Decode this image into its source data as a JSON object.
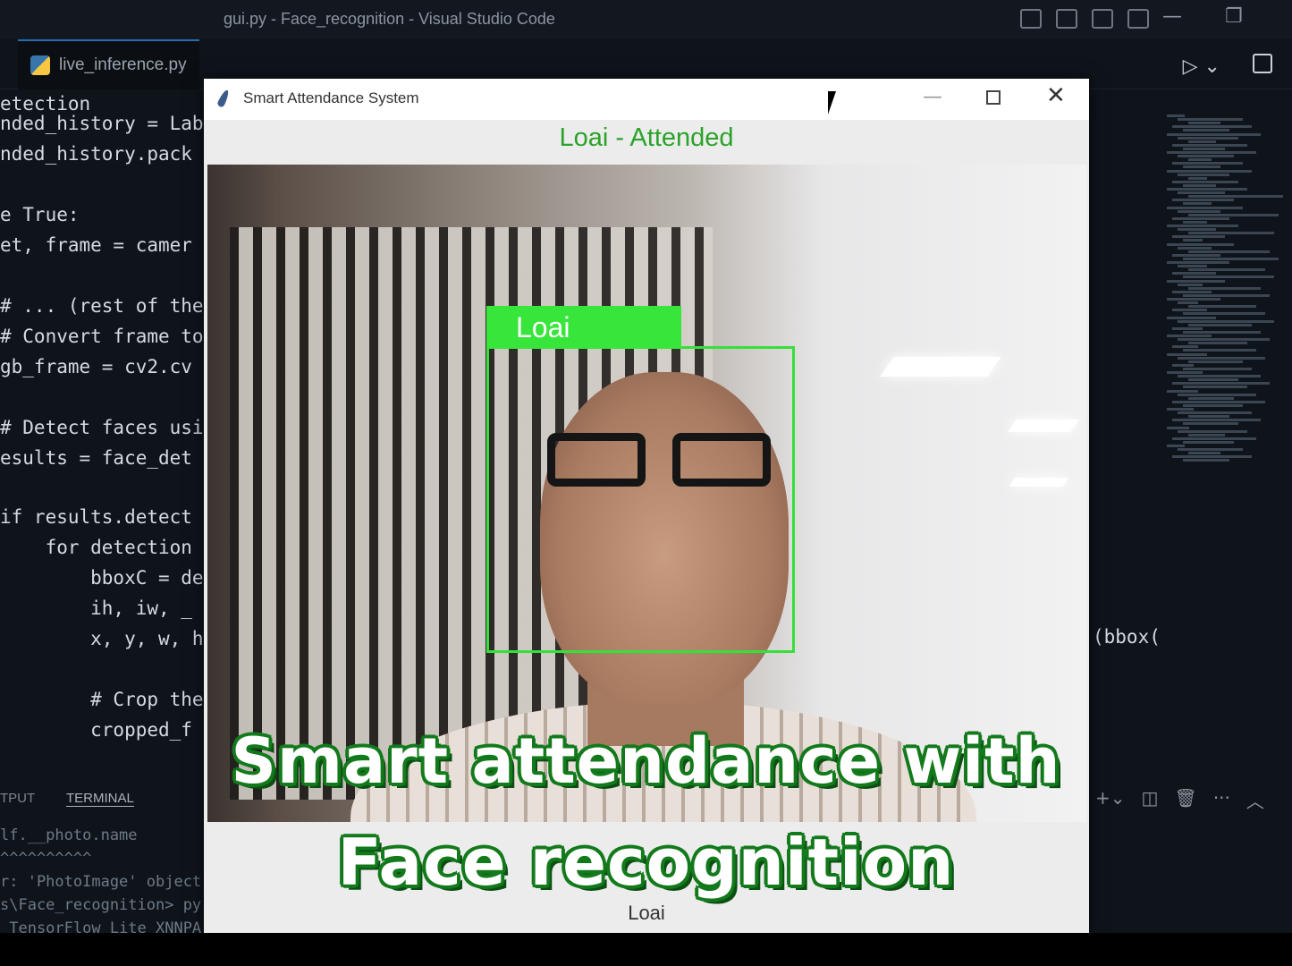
{
  "vscode": {
    "title": "gui.py - Face_recognition - Visual Studio Code",
    "tab_label": "live_inference.py",
    "code_lines": [
      {
        "text": "etection",
        "style": "plain"
      },
      {
        "text": "nded_history = Lab",
        "style": "plain"
      },
      {
        "text": "nded_history.pack",
        "style": "plain"
      },
      {
        "text": "e True:",
        "style": "kw"
      },
      {
        "text": "et, frame = camer",
        "style": "plain"
      },
      {
        "text": "# ... (rest of the",
        "style": "cm"
      },
      {
        "text": "# Convert frame to",
        "style": "cm"
      },
      {
        "text": "gb_frame = cv2.cv",
        "style": "plain"
      },
      {
        "text": "# Detect faces usi",
        "style": "cm"
      },
      {
        "text": "esults = face_det",
        "style": "plain"
      },
      {
        "text": "if results.detect",
        "style": "plain"
      },
      {
        "text": "    for detection",
        "style": "plain"
      },
      {
        "text": "        bboxC = de",
        "style": "plain"
      },
      {
        "text": "        ih, iw, _",
        "style": "plain"
      },
      {
        "text": "        x, y, w, h",
        "style": "plain"
      },
      {
        "text": "        # Crop the",
        "style": "cm"
      },
      {
        "text": "        cropped_f",
        "style": "plain"
      }
    ],
    "right_code": "(bbox(",
    "panel_output_tab": "TPUT",
    "panel_terminal_tab": "TERMINAL",
    "terminal_lines": [
      "lf.__photo.name",
      "^^^^^^^^^^",
      "r: 'PhotoImage' object",
      "s\\Face_recognition> py",
      " TensorFlow Lite XNNPA"
    ]
  },
  "app": {
    "window_title": "Smart Attendance System",
    "status_text": "Loai - Attended",
    "face_label": "Loai",
    "name_field": "Loai"
  },
  "caption": {
    "line1": "Smart attendance with",
    "line2": "Face recognition"
  },
  "colors": {
    "accent_green": "#37e53b",
    "status_green": "#2aa32a",
    "caption_outline": "#137a1c"
  }
}
